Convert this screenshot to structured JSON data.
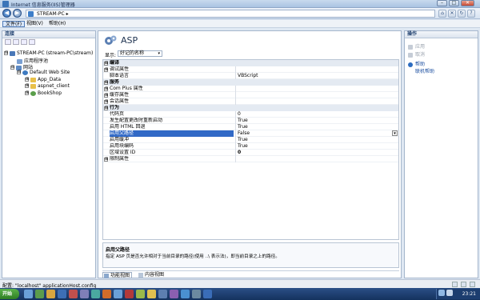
{
  "window": {
    "title": "Internet 信息服务(IIS)管理器",
    "controls": {
      "minimize": "–",
      "maximize": "□",
      "close": "✕"
    }
  },
  "address": {
    "path": "STREAM-PC  ▸",
    "back_label": "◀",
    "forward_label": "▶"
  },
  "toolbar_icons": [
    "home-icon",
    "stop-icon",
    "refresh-icon",
    "help-icon"
  ],
  "menu": {
    "items": [
      {
        "label": "文件(F)"
      },
      {
        "label": "视图(V)"
      },
      {
        "label": "帮助(H)"
      }
    ]
  },
  "connections": {
    "header": "连接",
    "tree": [
      {
        "label": "STREAM-PC (stream-PC\\stream)",
        "icon": "server-icon",
        "expander": "⊟",
        "indent": 0
      },
      {
        "label": "应用程序池",
        "icon": "app-pool-icon",
        "expander": "",
        "indent": 1
      },
      {
        "label": "网站",
        "icon": "sites-icon",
        "expander": "⊟",
        "indent": 1
      },
      {
        "label": "Default Web Site",
        "icon": "site-icon",
        "expander": "⊟",
        "indent": 2
      },
      {
        "label": "App_Data",
        "icon": "folder-icon",
        "expander": "⊞",
        "indent": 3
      },
      {
        "label": "aspnet_client",
        "icon": "folder-icon",
        "expander": "⊞",
        "indent": 3
      },
      {
        "label": "BookShop",
        "icon": "app-icon",
        "expander": "⊞",
        "indent": 3
      }
    ]
  },
  "main": {
    "title": "ASP",
    "display_label": "显示:",
    "display_value": "好记的名称",
    "grid": [
      {
        "kind": "cat",
        "name": "编译",
        "value": "",
        "exp": "⊟"
      },
      {
        "kind": "prop",
        "name": "调试属性",
        "value": "",
        "exp": "⊞"
      },
      {
        "kind": "prop",
        "name": "脚本语言",
        "value": "VBScript",
        "exp": ""
      },
      {
        "kind": "cat",
        "name": "服务",
        "value": "",
        "exp": "⊟"
      },
      {
        "kind": "prop",
        "name": "Com Plus 属性",
        "value": "",
        "exp": "⊞"
      },
      {
        "kind": "prop",
        "name": "缓存属性",
        "value": "",
        "exp": "⊞"
      },
      {
        "kind": "prop",
        "name": "会话属性",
        "value": "",
        "exp": "⊞"
      },
      {
        "kind": "cat",
        "name": "行为",
        "value": "",
        "exp": "⊟"
      },
      {
        "kind": "prop",
        "name": "代码页",
        "value": "0",
        "exp": ""
      },
      {
        "kind": "prop",
        "name": "发生配置更改时重新启动",
        "value": "True",
        "exp": ""
      },
      {
        "kind": "prop",
        "name": "启用 HTML 回退",
        "value": "True",
        "exp": ""
      },
      {
        "kind": "sel",
        "name": "启用父路径",
        "value": "False",
        "exp": ""
      },
      {
        "kind": "prop",
        "name": "启用缓冲",
        "value": "True",
        "exp": ""
      },
      {
        "kind": "prop",
        "name": "启用块编码",
        "value": "True",
        "exp": ""
      },
      {
        "kind": "bold",
        "name": "区域设置 ID",
        "value": "0",
        "exp": ""
      },
      {
        "kind": "prop",
        "name": "限制属性",
        "value": "",
        "exp": "⊞"
      }
    ],
    "description": {
      "title": "启用父路径",
      "text": "指定 ASP 页是否允许相对于当前目录的路径(使用 ..\\ 表示法)，即当前目录之上的路径。"
    },
    "view_tabs": [
      {
        "label": "功能视图",
        "active": true
      },
      {
        "label": "内容视图",
        "active": false
      }
    ]
  },
  "actions": {
    "header": "操作",
    "items": [
      {
        "label": "应用",
        "icon": "apply-icon",
        "state": "disabled"
      },
      {
        "label": "取消",
        "icon": "cancel-icon",
        "state": "disabled"
      },
      {
        "label": "帮助",
        "icon": "help-icon",
        "state": "link"
      },
      {
        "label": "联机帮助",
        "icon": "",
        "state": "link"
      }
    ]
  },
  "status": {
    "text": "配置: \"localhost\" applicationHost.config"
  },
  "taskbar": {
    "start_label": "开始",
    "clock": "23:21"
  }
}
